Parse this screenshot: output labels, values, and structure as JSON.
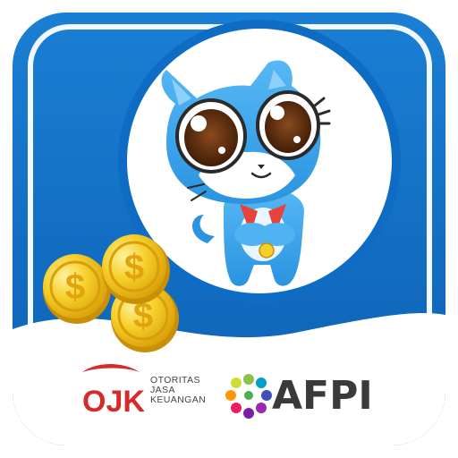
{
  "app_icon": {
    "name": "cat-loan-app-icon",
    "colors": {
      "brand_blue": "#0f6cc4",
      "frame_blue": "#1e86d8",
      "cat_blue": "#3fa9ee",
      "coin_gold": "#f5c518",
      "ojk_red": "#d62b2b",
      "afpi_text": "#3a3a3a"
    }
  },
  "logos": {
    "ojk": {
      "mark": "OJK",
      "lines": [
        "OTORITAS",
        "JASA",
        "KEUANGAN"
      ]
    },
    "afpi": {
      "text": "AFPI"
    }
  },
  "illustration": {
    "mascot": "cat-mascot-icon",
    "coins": "dollar-coin-icon",
    "coin_symbol": "$"
  }
}
